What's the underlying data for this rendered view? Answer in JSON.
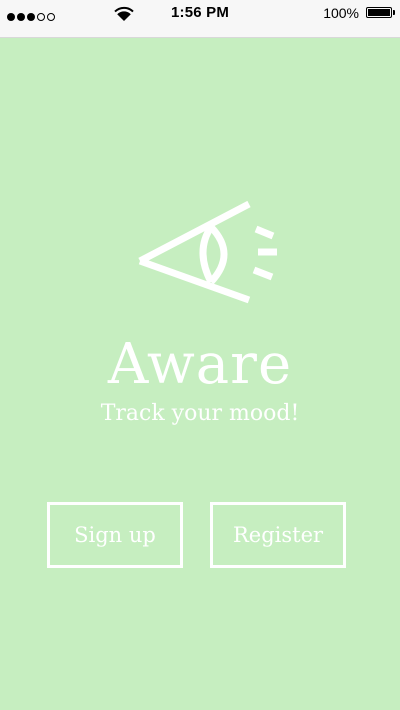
{
  "status_bar": {
    "time": "1:56 PM",
    "battery_percent": "100%",
    "battery_level": 1.0,
    "signal_bars_filled": 3,
    "signal_bars_total": 5,
    "icons": [
      "signal-dots-icon",
      "wifi-icon",
      "battery-icon"
    ]
  },
  "app": {
    "logo_icon": "eye-megaphone-icon",
    "title": "Aware",
    "tagline": "Track your mood!"
  },
  "buttons": {
    "signup_label": "Sign up",
    "register_label": "Register"
  },
  "colors": {
    "background": "#c6eec0",
    "foreground": "#ffffff",
    "status_bar": "#f7f7f7"
  }
}
